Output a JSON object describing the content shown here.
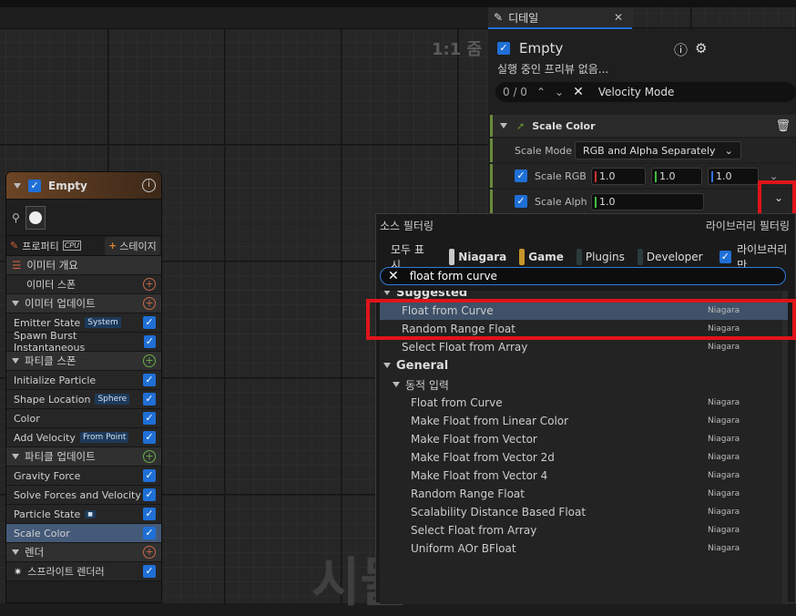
{
  "viewport": {
    "zoom_label": "1:1 줌",
    "watermark": "시뮬"
  },
  "emitter": {
    "name": "Empty",
    "tabs": {
      "properties": "프로퍼티",
      "cpu_badge": "CPU",
      "add_stage": "스테이지"
    },
    "rows": [
      {
        "label": "이미터 개요",
        "kind": "header-plain"
      },
      {
        "label": "이미터 스폰",
        "kind": "plus-orange"
      },
      {
        "label": "이미터 업데이트",
        "kind": "section-orange"
      },
      {
        "label": "Emitter State",
        "tag": "System",
        "kind": "check"
      },
      {
        "label": "Spawn Burst Instantaneous",
        "kind": "check"
      },
      {
        "label": "파티클 스폰",
        "kind": "section-green"
      },
      {
        "label": "Initialize Particle",
        "kind": "check"
      },
      {
        "label": "Shape Location",
        "tag": "Sphere",
        "kind": "check"
      },
      {
        "label": "Color",
        "kind": "check"
      },
      {
        "label": "Add Velocity",
        "tag": "From Point",
        "kind": "check"
      },
      {
        "label": "파티클 업데이트",
        "kind": "section-green"
      },
      {
        "label": "Gravity Force",
        "kind": "check"
      },
      {
        "label": "Solve Forces and Velocity",
        "kind": "check"
      },
      {
        "label": "Particle State",
        "kind": "check-dot"
      },
      {
        "label": "Scale Color",
        "kind": "check-selected"
      },
      {
        "label": "렌더",
        "kind": "section-orange"
      },
      {
        "label": "스프라이트 렌더러",
        "kind": "check-render"
      }
    ]
  },
  "details": {
    "tab_label": "디테일",
    "title": "Empty",
    "subtitle": "실행 중인 프리뷰 없음...",
    "search": {
      "counter": "0 / 0",
      "value": "Velocity Mode"
    },
    "module": "Scale Color",
    "scale_mode": {
      "label": "Scale Mode",
      "value": "RGB and Alpha Separately"
    },
    "scale_rgb": {
      "label": "Scale RGB",
      "values": [
        "1.0",
        "1.0",
        "1.0"
      ]
    },
    "scale_alpha": {
      "label": "Scale Alph",
      "value": "1.0"
    }
  },
  "popup": {
    "source_filter": "소스 필터링",
    "library_filter": "라이브러리 필터링",
    "show_all": "모두 표시",
    "chips": [
      {
        "label": "Niagara",
        "color": "#c8c8c8"
      },
      {
        "label": "Game",
        "color": "#c8962a"
      },
      {
        "label": "Plugins",
        "color": "#2b3b3b"
      },
      {
        "label": "Developer",
        "color": "#2b3b3b"
      }
    ],
    "library_only": "라이브러리만",
    "search_value": "float form curve",
    "suggested_label": "Suggested",
    "suggested": [
      {
        "name": "Float from Curve",
        "source": "Niagara"
      },
      {
        "name": "Random Range Float",
        "source": "Niagara"
      },
      {
        "name": "Select Float from Array",
        "source": "Niagara"
      }
    ],
    "general_label": "General",
    "dynamic_label": "동적 입력",
    "general": [
      {
        "name": "Float from Curve",
        "source": "Niagara"
      },
      {
        "name": "Make Float from Linear Color",
        "source": "Niagara"
      },
      {
        "name": "Make Float from Vector",
        "source": "Niagara"
      },
      {
        "name": "Make Float from Vector 2d",
        "source": "Niagara"
      },
      {
        "name": "Make Float from Vector 4",
        "source": "Niagara"
      },
      {
        "name": "Random Range Float",
        "source": "Niagara"
      },
      {
        "name": "Scalability Distance Based Float",
        "source": "Niagara"
      },
      {
        "name": "Select Float from Array",
        "source": "Niagara"
      },
      {
        "name": "Uniform AOr BFloat",
        "source": "Niagara"
      }
    ]
  }
}
